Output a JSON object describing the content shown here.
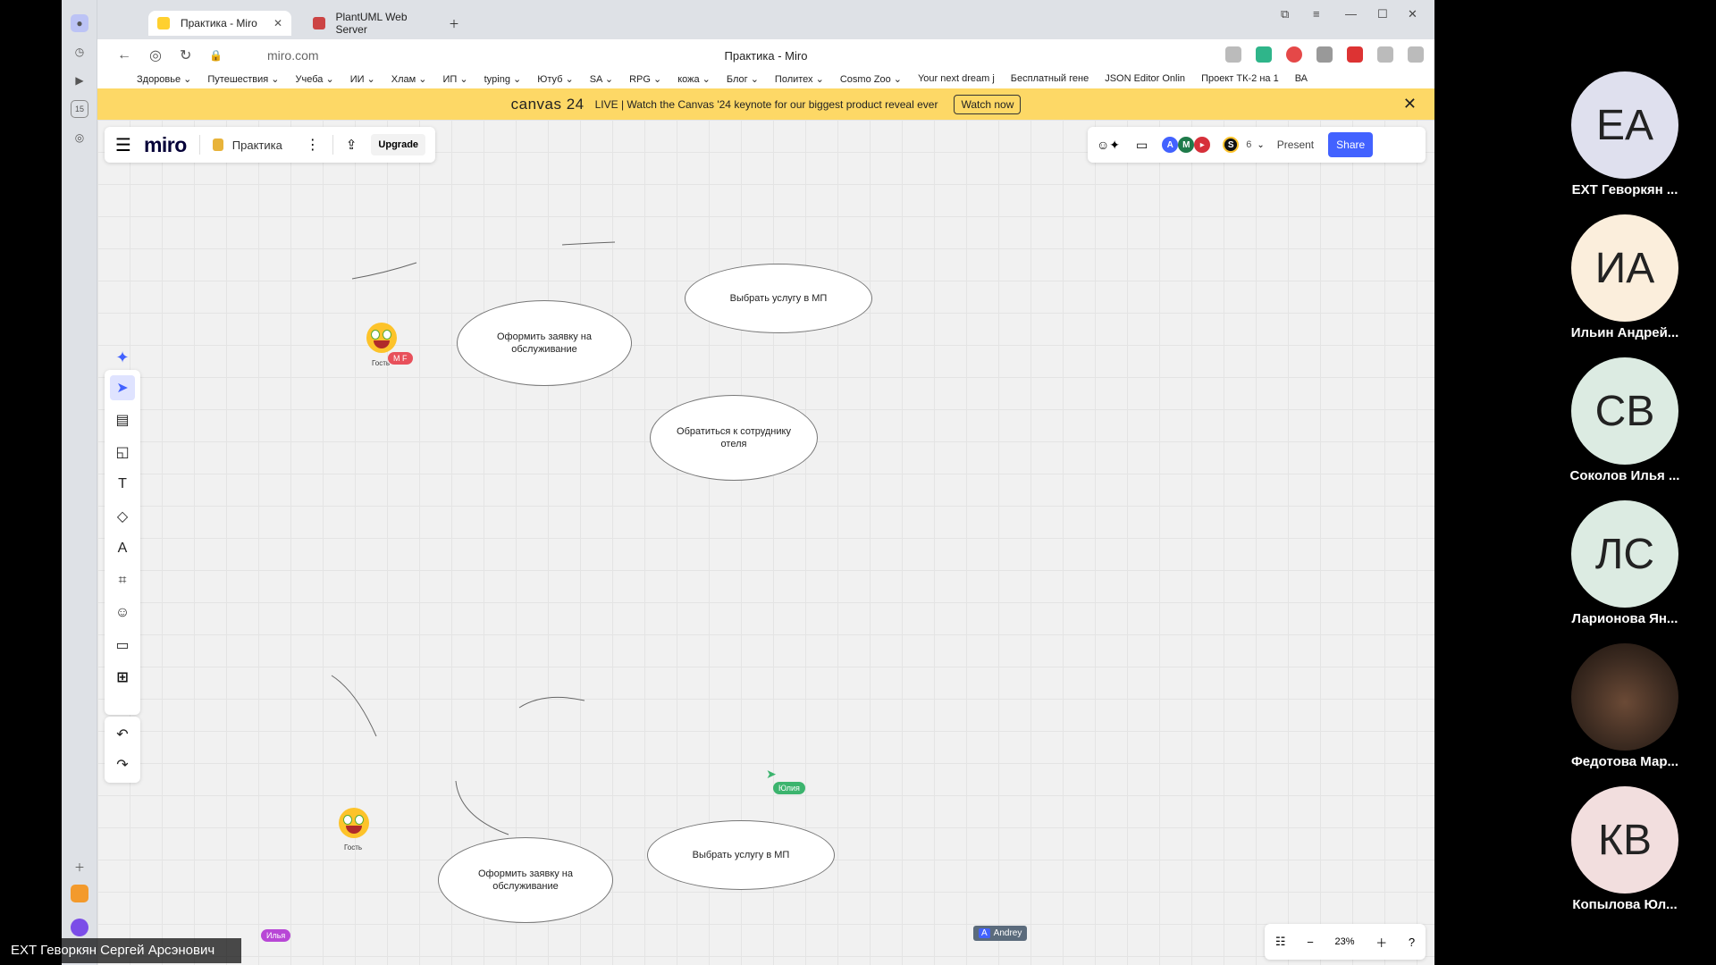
{
  "browser": {
    "tabs": [
      {
        "label": "Практика - Miro",
        "active": true
      },
      {
        "label": "PlantUML Web Server",
        "active": false
      }
    ],
    "url": "miro.com",
    "page_title": "Практика - Miro",
    "bookmarks": [
      "Здоровье ⌄",
      "Путешествия ⌄",
      "Учеба ⌄",
      "ИИ ⌄",
      "Хлам ⌄",
      "ИП ⌄",
      "typing ⌄",
      "Ютуб ⌄",
      "SA ⌄",
      "RPG ⌄",
      "кожа ⌄",
      "Блог ⌄",
      "Политех ⌄",
      "Cosmo Zoo ⌄",
      "Your next dream j",
      "Бесплатный гене",
      "JSON Editor Onlin",
      "Проект ТК-2 на 1",
      "ВА"
    ]
  },
  "banner": {
    "logo": "canvas 24",
    "text": "LIVE | Watch the Canvas '24 keynote for our biggest product reveal ever",
    "button": "Watch now"
  },
  "miro": {
    "brand": "miro",
    "board_name": "Практика",
    "upgrade": "Upgrade",
    "participants_count": "6",
    "present": "Present",
    "share": "Share",
    "avatars": [
      "A",
      "M",
      "S"
    ],
    "zoom": "23%"
  },
  "diagram": {
    "top": {
      "create_request": "Оформить заявку на обслуживание",
      "choose_service": "Выбрать услугу в МП",
      "contact_staff": "Обратиться к сотруднику отеля"
    },
    "bottom": {
      "create_request": "Оформить заявку на обслуживание",
      "choose_service": "Выбрать услугу в МП"
    },
    "guest_label": "Гость"
  },
  "cursors": {
    "mf": "M F",
    "yulia": "Юлия",
    "ilya": "Илья",
    "andrey": "Andrey",
    "andrey_initial": "A"
  },
  "colors": {
    "miro_blue": "#4262ff",
    "banner_yellow": "#fdd866",
    "yulia_green": "#3cb46e",
    "mf_red": "#e8505b",
    "ilya_purple": "#b847d6",
    "andrey_slate": "#5b6b7c"
  },
  "participants": [
    {
      "initials": "ЕА",
      "name": "EXT Геворкян ...",
      "bg": "#dfe0ee"
    },
    {
      "initials": "ИА",
      "name": "Ильин Андрей...",
      "bg": "#fbeedc"
    },
    {
      "initials": "СВ",
      "name": "Соколов Илья ...",
      "bg": "#dcebe2"
    },
    {
      "initials": "ЛС",
      "name": "Ларионова Ян...",
      "bg": "#dcebe2"
    },
    {
      "initials": "",
      "name": "Федотова Мар...",
      "bg": "#3b2a20"
    },
    {
      "initials": "КВ",
      "name": "Копылова Юл...",
      "bg": "#f2dede"
    }
  ],
  "self_name": "EXT Геворкян Сергей Арсэнович"
}
